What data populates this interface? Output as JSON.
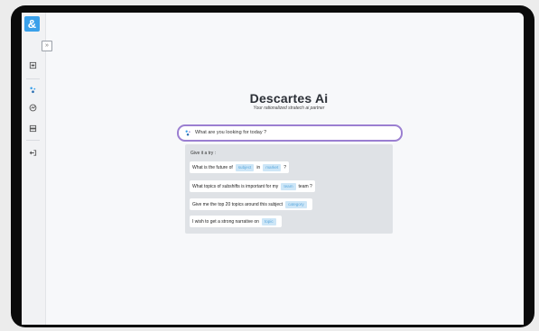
{
  "app": {
    "logo_text": "&"
  },
  "sidebar": {
    "collapse_label": "»",
    "items": [
      {
        "name": "documents-icon"
      },
      {
        "name": "sparkle-icon"
      },
      {
        "name": "analytics-icon"
      },
      {
        "name": "database-icon"
      },
      {
        "name": "logout-icon"
      }
    ]
  },
  "hero": {
    "title": "Descartes Ai",
    "subtitle": "Your rationalized stratech ai partner"
  },
  "search": {
    "placeholder": "What are you looking for today ?"
  },
  "suggestions": {
    "title": "Give it a try :",
    "prompts": [
      {
        "parts": [
          "What is the future of",
          "in",
          "?"
        ],
        "chips": [
          "subject",
          "market"
        ]
      },
      {
        "parts": [
          "What topics of subshifts is important for my",
          "team ?"
        ],
        "chips": [
          "team"
        ]
      },
      {
        "parts": [
          "Give me the top 20 topics around this subject"
        ],
        "chips": [
          "category"
        ]
      },
      {
        "parts": [
          "I wish to get a strong narrative on"
        ],
        "chips": [
          "topic"
        ]
      }
    ]
  },
  "colors": {
    "accent": "#3aa0ea",
    "search_border": "#9b7fd1",
    "chip_bg": "#cde6f7",
    "chip_text": "#59a7dd"
  }
}
